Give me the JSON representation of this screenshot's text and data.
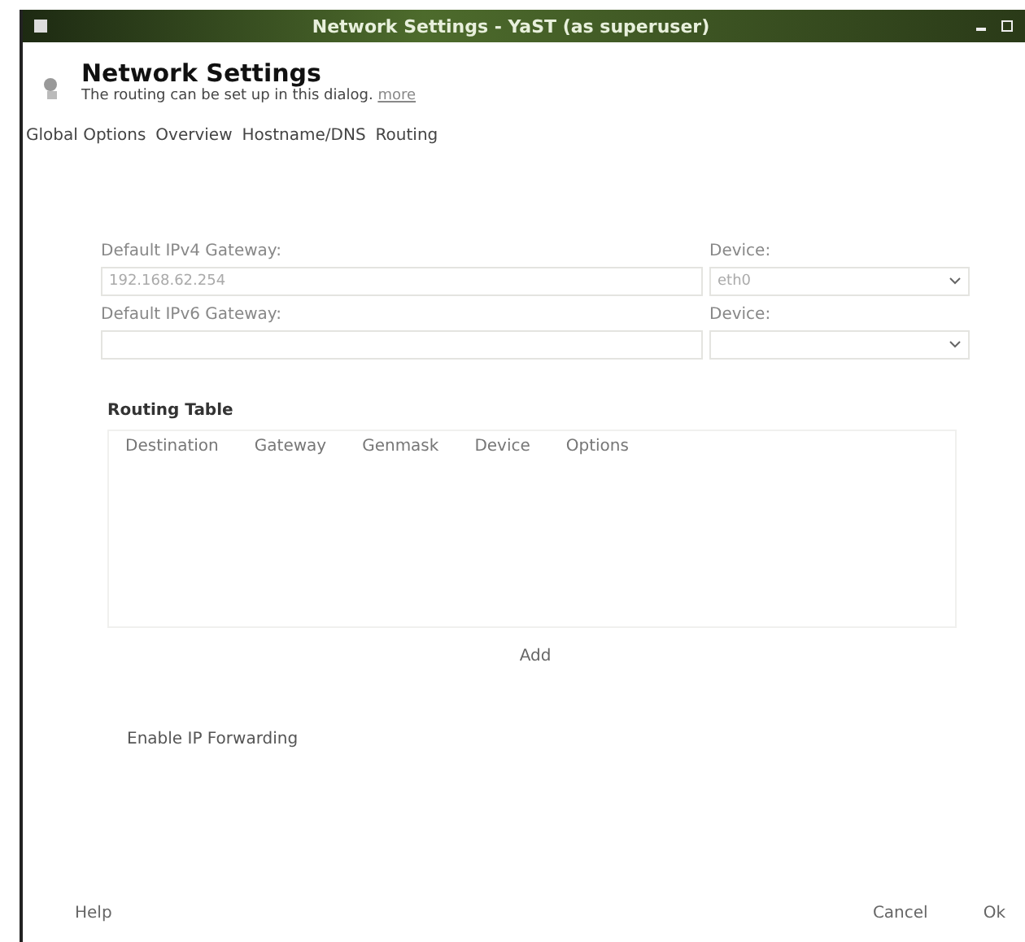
{
  "window": {
    "title": "Network Settings - YaST (as superuser)"
  },
  "header": {
    "title": "Network Settings",
    "subtitle": "The routing can be set up in this dialog.",
    "more_link": "more"
  },
  "tabs": [
    {
      "label": "Global Options"
    },
    {
      "label": "Overview"
    },
    {
      "label": "Hostname/DNS"
    },
    {
      "label": "Routing"
    }
  ],
  "gateways": [
    {
      "label": "Default IPv4 Gateway:",
      "value": "192.168.62.254",
      "device_label": "Device:",
      "device": "eth0"
    },
    {
      "label": "Default IPv6 Gateway:",
      "device_label": "Device:"
    }
  ],
  "routing_table": {
    "title": "Routing Table",
    "columns": [
      "Destination",
      "Gateway",
      "Genmask",
      "Device",
      "Options"
    ]
  },
  "add_button": "Add",
  "ip_forwarding": {
    "label": "Enable IP Forwarding"
  },
  "footer": {
    "help": "Help",
    "cancel": "Cancel",
    "ok": "Ok"
  }
}
